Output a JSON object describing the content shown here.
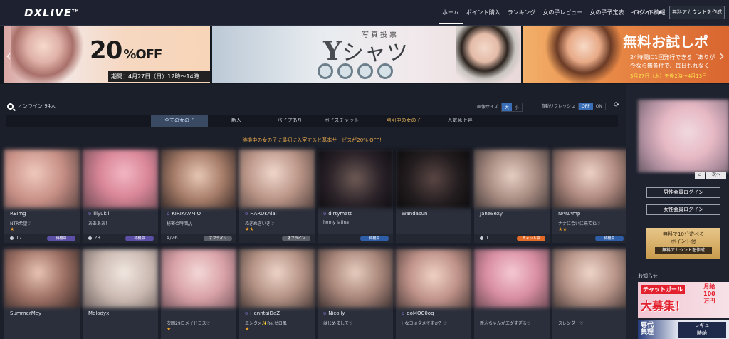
{
  "header": {
    "logo": "DXLIVE",
    "logo_tm": "TM",
    "nav": [
      "ホーム",
      "ポイント購入",
      "ランキング",
      "女の子レビュー",
      "女の子予定表",
      "イベント情報"
    ],
    "login": "ログイン ▾",
    "create_account": "無料アカウントを作成"
  },
  "banners": {
    "b1": {
      "big": "20",
      "unit": "%OFF",
      "period": "期間：4月27日（日）12時～14時"
    },
    "b2": {
      "title_y": "Y",
      "title_rest": "シャツ",
      "sub": "写真投票"
    },
    "b3": {
      "title": "無料お試しポ",
      "line1": "24時間に1回発行できる「ありが",
      "line2": "今なら無条件で、毎日もれなく",
      "date": "3月27日（木）午後2時～4月13日"
    }
  },
  "controls": {
    "online_label": "オンライン 94人",
    "size_label": "画像サイズ",
    "size_options": [
      "大",
      "小"
    ],
    "refresh_label": "自動リフレッシュ",
    "refresh_options": [
      "OFF",
      "ON"
    ]
  },
  "tabs": [
    "全ての女の子",
    "新人",
    "パイプあり",
    "ボイスチャット",
    "割引中の女の子",
    "人気急上昇"
  ],
  "notice": "待機中の女の子に最初に入室すると基本サービスが20% OFF！",
  "cards": [
    {
      "name": "REImg",
      "msg": "NTR希望♡",
      "stars": "★",
      "count": "17",
      "badge": "待機中"
    },
    {
      "name": "iiiyukiii",
      "msg": "ああああ！",
      "stars": "",
      "count": "23",
      "badge": "待機中"
    },
    {
      "name": "KIRIKAVMIO",
      "msg": "秘密の時間///",
      "stars": "",
      "count": "4/26",
      "badge": "オフライン"
    },
    {
      "name": "HARUKAiai",
      "msg": "ぬぎぬぎいき♡",
      "stars": "★★",
      "count": "",
      "badge": "オフライン"
    },
    {
      "name": "dirtymatt",
      "msg": "horny latina",
      "stars": "",
      "count": "",
      "badge": "待機中"
    },
    {
      "name": "Wandasun",
      "msg": "",
      "stars": "",
      "count": "",
      "badge": ""
    },
    {
      "name": "JaneSexy",
      "msg": "",
      "stars": "",
      "count": "1",
      "badge": "チャット中"
    },
    {
      "name": "NANAmp",
      "msg": "ナナに会いに来てね♡",
      "stars": "★★",
      "count": "",
      "badge": "待機中"
    },
    {
      "name": "SummerMey",
      "msg": "",
      "stars": "",
      "count": "",
      "badge": ""
    },
    {
      "name": "Melodyx",
      "msg": "",
      "stars": "",
      "count": "",
      "badge": ""
    },
    {
      "name": "",
      "msg": "次回29日メイドコス♡",
      "stars": "★",
      "count": "",
      "badge": ""
    },
    {
      "name": "HenntaiDaZ",
      "msg": "エンタメ✨Re:ゼロ風",
      "stars": "★",
      "count": "",
      "badge": ""
    },
    {
      "name": "Nicolly",
      "msg": "はじめまして♡",
      "stars": "",
      "count": "",
      "badge": ""
    },
    {
      "name": "qoMOC0oq",
      "msg": "Hなコはダメですか？♡",
      "stars": "",
      "count": "",
      "badge": ""
    },
    {
      "name": "",
      "msg": "新人ちゃんがエグすぎる♡",
      "stars": "",
      "count": "",
      "badge": ""
    },
    {
      "name": "",
      "msg": "スレンダー♡",
      "stars": "",
      "count": "",
      "badge": ""
    }
  ],
  "sidebar": {
    "home": "⌂",
    "next": "次へ",
    "male_login": "男性会員ログイン",
    "female_login": "女性会員ログイン",
    "free_line1": "無料で10分遊べる",
    "free_line2": "ポイント付",
    "free_btn": "無料アカウントを作成",
    "news": "お知らせ",
    "ad1_h": "チャットガール",
    "ad1_h2": "大募集！",
    "ad1_r": "月給\n100\n万円",
    "ad2_h": "専代\n集理",
    "ad2_h3": "レギュ\n時給"
  }
}
